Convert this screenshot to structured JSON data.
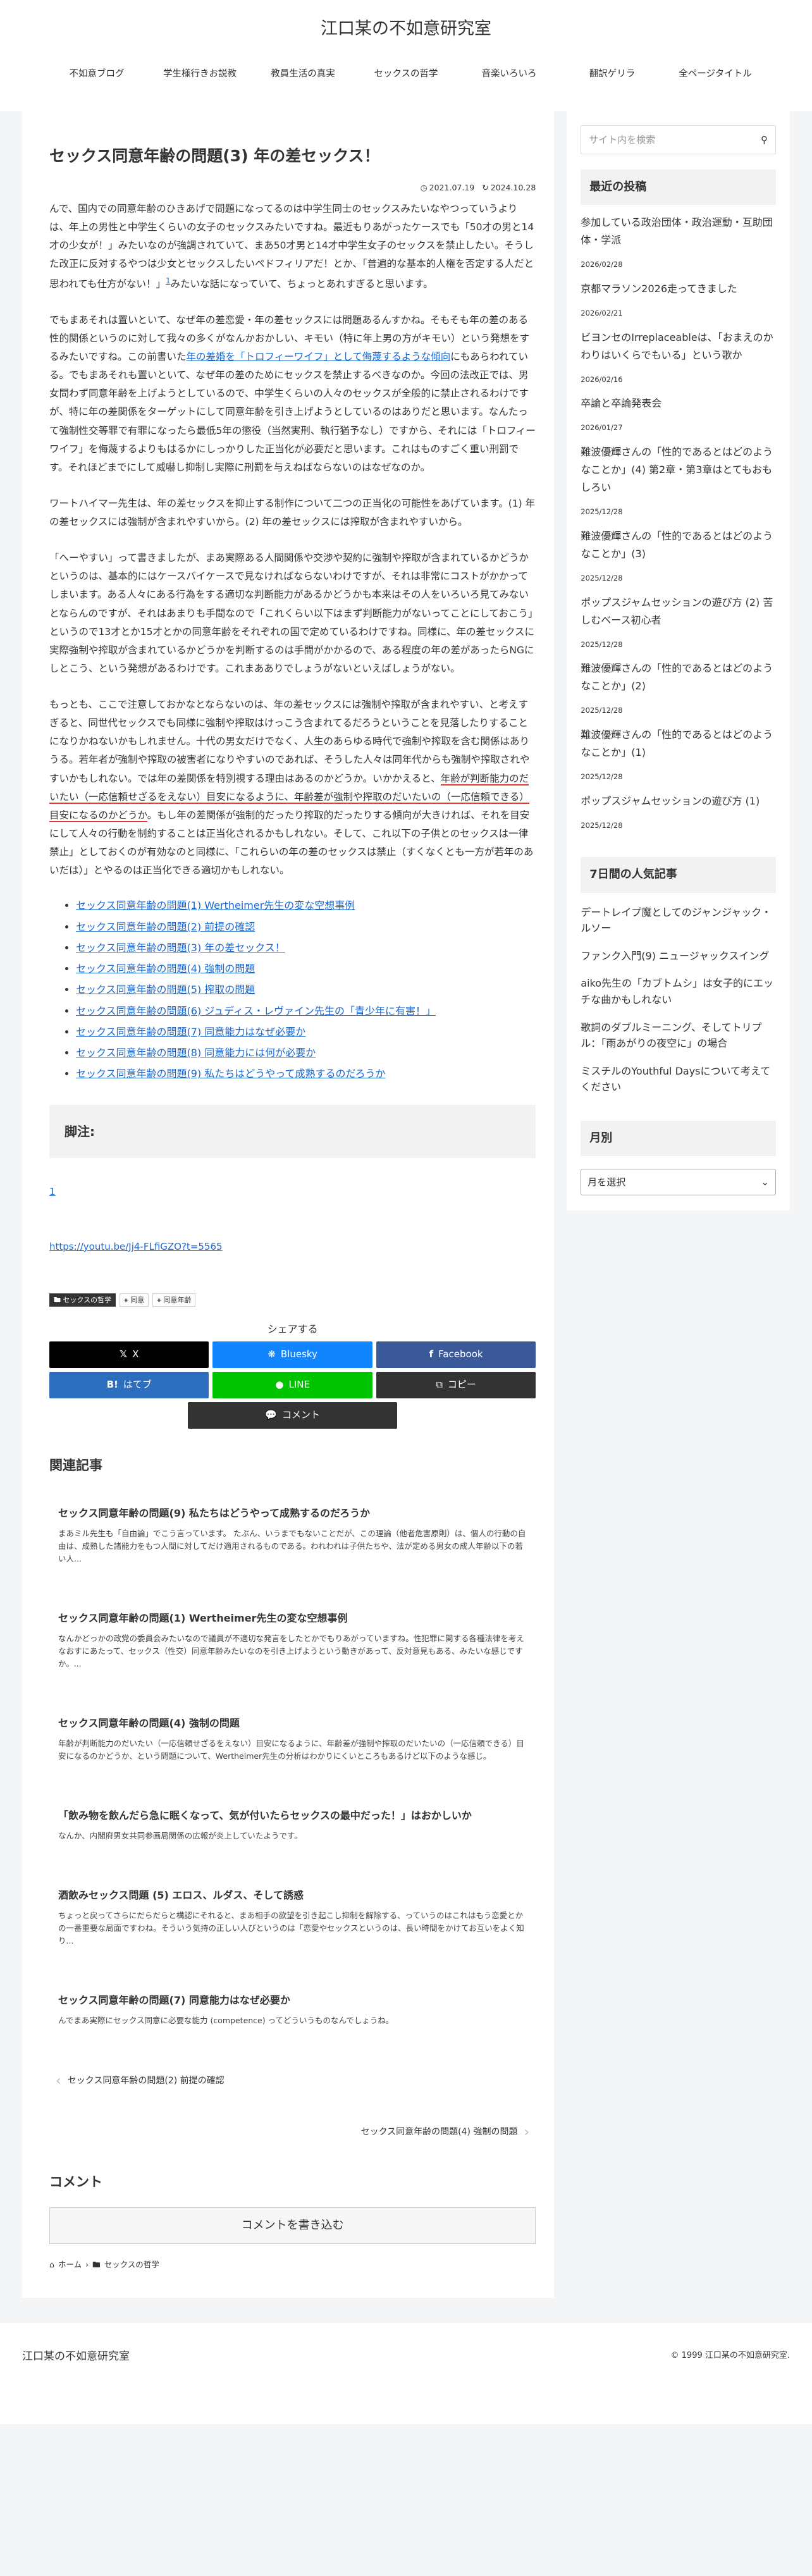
{
  "site": {
    "title": "江口某の不如意研究室"
  },
  "nav": [
    "不如意ブログ",
    "学生様行きお説教",
    "教員生活の真実",
    "セックスの哲学",
    "音楽いろいろ",
    "翻訳ゲリラ",
    "全ページタイトル"
  ],
  "article": {
    "title": "セックス同意年齢の問題(3) 年の差セックス！",
    "published": "2021.07.19",
    "updated": "2024.10.28",
    "p1": "んで、国内での同意年齢のひきあげで問題になってるのは中学生同士のセックスみたいなやつっていうよりは、年上の男性と中学生くらいの女子のセックスみたいですね。最近もりあがったケースでも「50才の男と14才の少女が！」みたいなのが強調されていて、まあ50才男と14才中学生女子のセックスを禁止したい。そうした改正に反対するやつは少女とセックスしたいペドフィリアだ！とか、「普遍的な基本的人権を否定する人だと思われても仕方がない！」",
    "p1_sup": "1",
    "p1_end": "みたいな話になっていて、ちょっとあれすぎると思います。",
    "p2_a": "でもまあそれは置いといて、なぜ年の差恋愛・年の差セックスには問題あるんすかね。そもそも年の差のある性的関係というのに対して我々の多くがなんかおかしい、キモい（特に年上男の方がキモい）という発想をするみたいですね。この前書いた",
    "p2_link": "年の差婚を「トロフィーワイフ」として侮蔑するような傾向",
    "p2_b": "にもあらわれている。でもまあそれも置いといて、なぜ年の差のためにセックスを禁止するべきなのか。今回の法改正では、男女問わず同意年齢を上げようとしているので、中学生くらいの人々のセックスが全般的に禁止されるわけですが、特に年の差関係をターゲットにして同意年齢を引き上げようとしているのはありだと思います。なんたって強制性交等罪で有罪になったら最低5年の懲役（当然実刑、執行猶予なし）ですから、それには「トロフィーワイフ」を侮蔑するよりもはるかにしっかりした正当化が必要だと思います。これはものすごく重い刑罰です。それほどまでにして威嚇し抑制し実際に刑罰を与えねばならないのはなぜなのか。",
    "p3": "ワートハイマー先生は、年の差セックスを抑止する制作について二つの正当化の可能性をあげています。(1) 年の差セックスには強制が含まれやすいから。(2) 年の差セックスには搾取が含まれやすいから。",
    "p4": "「へーやすい」って書きましたが、まあ実際ある人間関係や交渉や契約に強制や搾取が含まれているかどうかというのは、基本的にはケースバイケースで見なければならないわけですが、それは非常にコストがかかってしまいます。ある人々にある行為をする適切な判断能力があるかどうかも本来はその人をいろいろ見てみないとならんのですが、それはあまりも手間なので「これくらい以下はまず判断能力がないってことにしておこう」というので13才とか15才とかの同意年齢をそれぞれの国で定めているわけですね。同様に、年の差セックスに実際強制や搾取が含まれているかどうかを判断するのは手間がかかるので、ある程度の年の差があったらNGにしとこう、という発想があるわけです。これまあありでしょうがないといえばしょうがない。",
    "p5_a": "もっとも、ここで注意しておかなとならないのは、年の差セックスには強制や搾取が含まれやすい、と考えすぎると、同世代セックスでも同様に強制や搾取はけっこう含まれてるだろうということを見落したりすることになりかねないかもしれません。十代の男女だけでなく、人生のあらゆる時代で強制や搾取を含む関係はありうる。若年者が強制や搾取の被害者になりやすいのであれば、そうした人々は同年代からも強制や搾取されやすいかもしれない。では年の差関係を特別視する理由はあるのかどうか。いかかえると、",
    "p5_u": "年齢が判断能力のだいたい（一応信頼せざるをえない）目安になるように、年齢差が強制や搾取のだいたいの（一応信頼できる）目安になるのかどうか",
    "p5_b": "。もし年の差関係が強制的だったり搾取的だったりする傾向が大きければ、それを目安にして人々の行動を制約することは正当化されるかもしれない。そして、これ以下の子供とのセックスは一律禁止」としておくのが有効なのと同様に、「これらいの年の差のセックスは禁止（すくなくとも一方が若年のあいだは）」とやるのは正当化できる適切かもしれない。"
  },
  "toc": [
    "セックス同意年齢の問題(1) Wertheimer先生の変な空想事例",
    "セックス同意年齢の問題(2) 前提の確認",
    "セックス同意年齢の問題(3) 年の差セックス！",
    "セックス同意年齢の問題(4) 強制の問題",
    "セックス同意年齢の問題(5) 搾取の問題",
    "セックス同意年齢の問題(6) ジュディス・レヴァイン先生の「青少年に有害！」",
    "セックス同意年齢の問題(7) 同意能力はなぜ必要か",
    "セックス同意年齢の問題(8) 同意能力には何が必要か",
    "セックス同意年齢の問題(9) 私たちはどうやって成熟するのだろうか"
  ],
  "footnotes": {
    "heading": "脚注:",
    "num": "1",
    "url": "https://youtu.be/Jj4-FLfiGZO?t=5565"
  },
  "tags": [
    "セックスの哲学",
    "同意",
    "同意年齢"
  ],
  "share": {
    "heading": "シェアする",
    "x": "X",
    "bluesky": "Bluesky",
    "facebook": "Facebook",
    "hatena": "はてブ",
    "line": "LINE",
    "copy": "コピー",
    "comment": "コメント",
    "colors": {
      "x": "#000000",
      "bluesky": "#1185fe",
      "facebook": "#3b5998",
      "hatena": "#2c6ebd",
      "line": "#00c300",
      "copy": "#333333",
      "comment": "#333333"
    }
  },
  "related": {
    "heading": "関連記事",
    "items": [
      {
        "title": "セックス同意年齢の問題(9) 私たちはどうやって成熟するのだろうか",
        "snippet": "まあミル先生も「自由論」でこう言っています。 たぶん、いうまでもないことだが、この理論（他者危害原則）は、個人の行動の自由は、成熟した諸能力をもつ人間に対してだけ適用されるものである。われわれは子供たちや、法が定める男女の成人年齢以下の若い人..."
      },
      {
        "title": "セックス同意年齢の問題(1) Wertheimer先生の変な空想事例",
        "snippet": "なんかどっかの政党の委員会みたいなので議員が不適切な発言をしたとかでもりあがっていますね。性犯罪に関する各種法律を考えなおすにあたって、セックス（性交）同意年齢みたいなのを引き上げようという動きがあって、反対意見もある、みたいな感じですか。..."
      },
      {
        "title": "セックス同意年齢の問題(4) 強制の問題",
        "snippet": "年齢が判断能力のだいたい（一応信頼せざるをえない）目安になるように、年齢差が強制や搾取のだいたいの（一応信頼できる）目安になるのかどうか、という問題について、Wertheimer先生の分析はわかりにくいところもあるけど以下のような感じ。"
      },
      {
        "title": "「飲み物を飲んだら急に眠くなって、気が付いたらセックスの最中だった！」はおかしいか",
        "snippet": "なんか、内閣府男女共同参画局関係の広報が炎上していたようです。"
      },
      {
        "title": "酒飲みセックス問題 (5) エロス、ルダス、そして誘惑",
        "snippet": "ちょっと戻ってさらにだらだらと構認にそれると、まあ相手の欲望を引き起こし抑制を解除する、っていうのはこれはもう恋愛とかの一番重要な局面ですわね。そういう気持の正しい人びというのは「恋愛やセックスというのは、長い時間をかけてお互いをよく知り..."
      },
      {
        "title": "セックス同意年齢の問題(7) 同意能力はなぜ必要か",
        "snippet": "んでまあ実際にセックス同意に必要な能力 (competence) ってどういうものなんでしょうね。"
      }
    ]
  },
  "pager": {
    "prev": "セックス同意年齢の問題(2) 前提の確認",
    "next": "セックス同意年齢の問題(4) 強制の問題"
  },
  "comments": {
    "heading": "コメント",
    "button": "コメントを書き込む"
  },
  "breadcrumb": {
    "home": "ホーム",
    "category": "セックスの哲学"
  },
  "sidebar": {
    "search_placeholder": "サイト内を検索",
    "recent_heading": "最近の投稿",
    "recent": [
      {
        "title": "参加している政治団体・政治運動・互助団体・学派",
        "date": "2026/02/28"
      },
      {
        "title": "京都マラソン2026走ってきました",
        "date": "2026/02/21"
      },
      {
        "title": "ビヨンセのIrreplaceableは、「おまえのかわりはいくらでもいる」という歌か",
        "date": "2026/02/16"
      },
      {
        "title": "卒論と卒論発表会",
        "date": "2026/01/27"
      },
      {
        "title": "難波優輝さんの「性的であるとはどのようなことか」(4) 第2章・第3章はとてもおもしろい",
        "date": "2025/12/28"
      },
      {
        "title": "難波優輝さんの「性的であるとはどのようなことか」(3)",
        "date": "2025/12/28"
      },
      {
        "title": "ポップスジャムセッションの遊び方 (2) 苦しむベース初心者",
        "date": "2025/12/28"
      },
      {
        "title": "難波優輝さんの「性的であるとはどのようなことか」(2)",
        "date": "2025/12/28"
      },
      {
        "title": "難波優輝さんの「性的であるとはどのようなことか」(1)",
        "date": "2025/12/28"
      },
      {
        "title": "ポップスジャムセッションの遊び方 (1)",
        "date": "2025/12/28"
      }
    ],
    "popular_heading": "7日間の人気記事",
    "popular": [
      "デートレイプ魔としてのジャンジャック・ルソー",
      "ファンク入門(9) ニュージャックスイング",
      "aiko先生の「カブトムシ」は女子的にエッチな曲かもしれない",
      "歌詞のダブルミーニング、そしてトリプル：「雨あがりの夜空に」の場合",
      "ミスチルのYouthful Daysについて考えてください"
    ],
    "archive_heading": "月別",
    "archive_select": "月を選択"
  },
  "footer": {
    "logo": "江口某の不如意研究室",
    "copyright": "© 1999 江口某の不如意研究室."
  }
}
